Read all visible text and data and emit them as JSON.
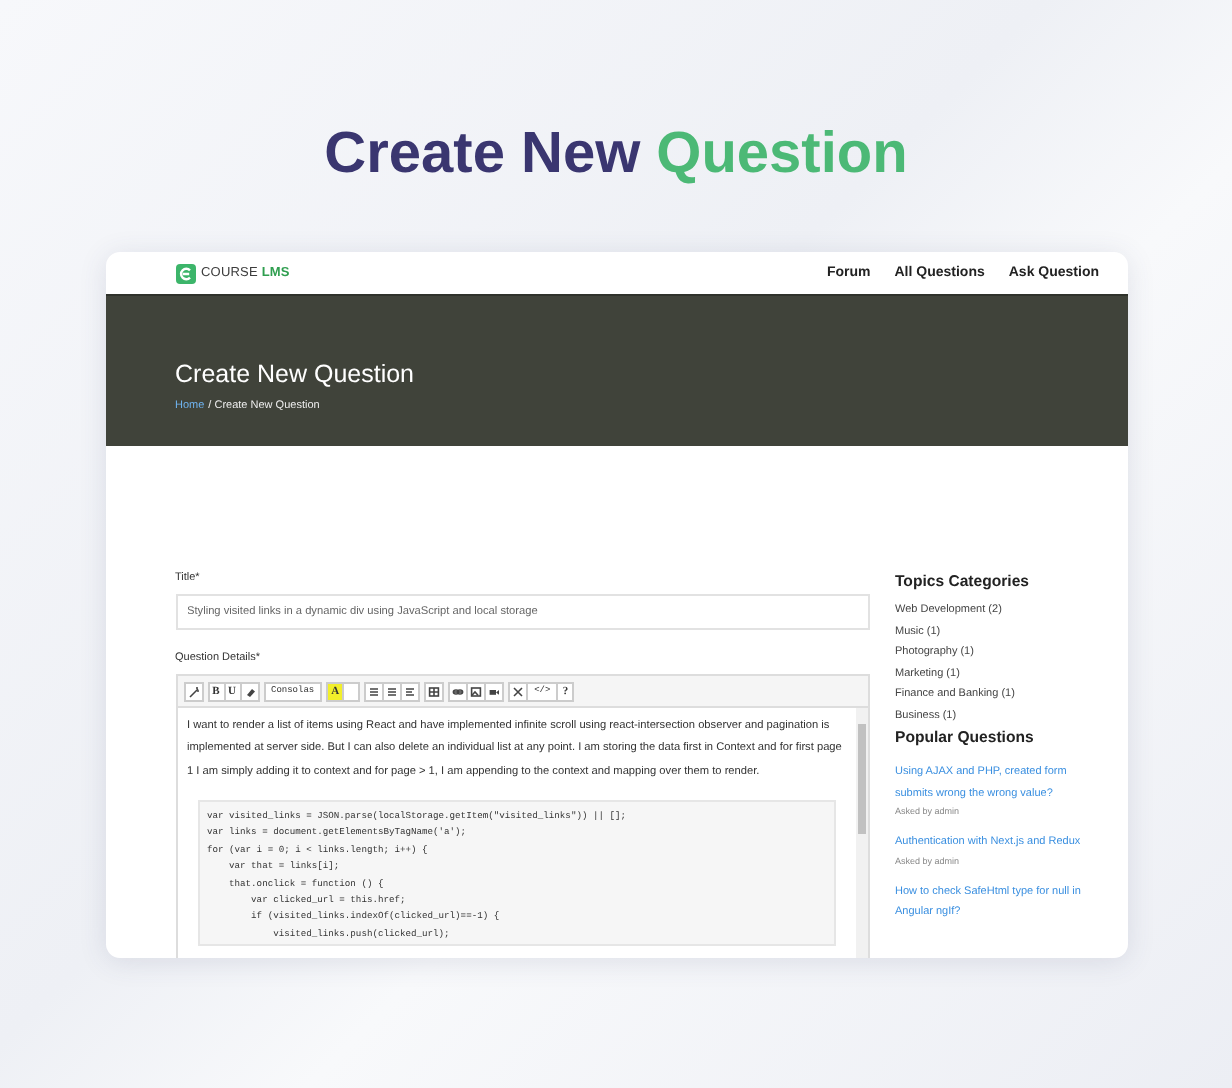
{
  "heading": {
    "lead": "Create New",
    "accent": "Question"
  },
  "nav": {
    "logo": "COURSE **LMS**",
    "links": [
      "Forum",
      "All Questions",
      "Ask Question"
    ]
  },
  "hero": {
    "title": "Create New Question",
    "breadcrumb": [
      {
        "label": "Home",
        "kind": "link"
      },
      {
        "label": "/ Create New Question",
        "kind": "current"
      }
    ]
  },
  "form": {
    "title_label": "Title*",
    "title_value": "Styling visited links in a dynamic div using JavaScript and local storage",
    "details_label": "Question Details*",
    "toolbar": {
      "bold": "B",
      "underline": "U",
      "font": "Consolas",
      "highlight": "A",
      "code": "</>",
      "help": "?"
    },
    "paragraph": "I want to render a list of items using React and have implemented infinite scroll using react-intersection observer and pagination is implemented at server side. But I can also delete an individual list at any point. I am storing the data first in Context and for first page 1 I am simply adding it to context and for page > 1, I am appending to the context and mapping over them to render.",
    "code": [
      "var visited_links = JSON.parse(localStorage.getItem(\"visited_links\")) || [];",
      "var links = document.getElementsByTagName('a');",
      "for (var i = 0; i < links.length; i++) {",
      "    var that = links[i];",
      "    that.onclick = function () {",
      "        var clicked_url = this.href;",
      "        if (visited_links.indexOf(clicked_url)==-1) {",
      "            visited_links.push(clicked_url);"
    ]
  },
  "sidebar": {
    "topics_title": "Topics Categories",
    "topics": [
      "Web Development (2)",
      "Music (1)",
      "Photography (1)",
      "Marketing (1)",
      "Finance and Banking (1)",
      "Business (1)"
    ],
    "popular_title": "Popular Questions",
    "questions": [
      {
        "title": "Using AJAX and PHP, created form submits wrong the wrong value?",
        "meta": "Asked by admin"
      },
      {
        "title": "Authentication with Next.js and Redux",
        "meta": "Asked by admin"
      },
      {
        "title": "How to check SafeHtml type for null in Angular ngIf?"
      }
    ]
  }
}
